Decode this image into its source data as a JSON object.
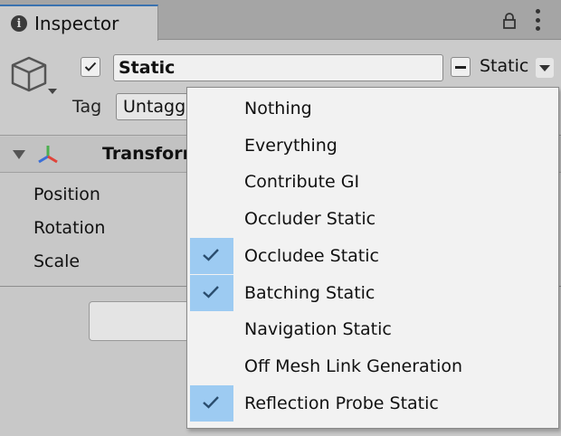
{
  "tab": {
    "label": "Inspector"
  },
  "gameobject": {
    "name": "Static",
    "active": true,
    "static_label": "Static",
    "tag_label": "Tag",
    "tag_value": "Untagged"
  },
  "component": {
    "title": "Transform",
    "properties": [
      "Position",
      "Rotation",
      "Scale"
    ]
  },
  "static_menu": {
    "items": [
      {
        "label": "Nothing",
        "checked": false
      },
      {
        "label": "Everything",
        "checked": false
      },
      {
        "label": "Contribute GI",
        "checked": false
      },
      {
        "label": "Occluder Static",
        "checked": false
      },
      {
        "label": "Occludee Static",
        "checked": true
      },
      {
        "label": "Batching Static",
        "checked": true
      },
      {
        "label": "Navigation Static",
        "checked": false
      },
      {
        "label": "Off Mesh Link Generation",
        "checked": false
      },
      {
        "label": "Reflection Probe Static",
        "checked": true
      }
    ]
  },
  "colors": {
    "check_highlight": "#9dcbf2",
    "tab_accent": "#3a72b0",
    "transform_x": "#e0443a",
    "transform_y": "#4caf50",
    "transform_z": "#3b6fd8"
  }
}
